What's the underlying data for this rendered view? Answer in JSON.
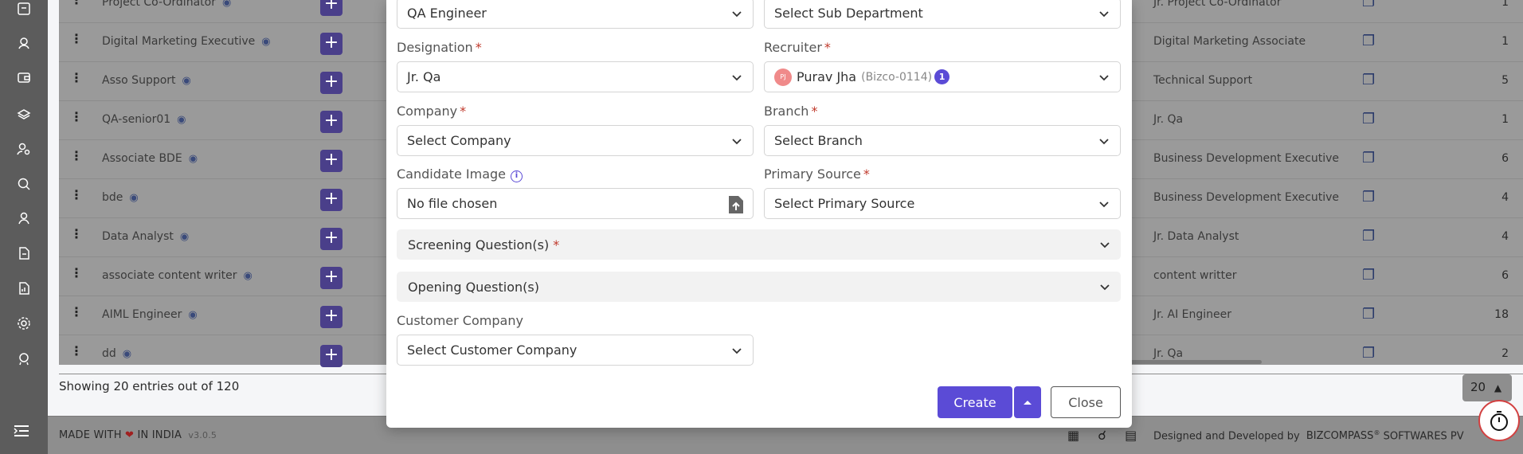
{
  "sidebar": {
    "icons": [
      "archive-icon",
      "users-icon",
      "wallet-icon",
      "layers-icon",
      "user-search-icon",
      "search-person-icon",
      "hr-icon",
      "document-icon",
      "report-icon",
      "settings-icon",
      "support-icon"
    ],
    "menu_icon": "menu-collapse-icon"
  },
  "background_table": {
    "rows": [
      {
        "name": "Project Co-Ordinator",
        "designation": "Jr. Project Co-Ordinator",
        "count": "1"
      },
      {
        "name": "Digital Marketing Executive",
        "designation": "Digital Marketing Associate",
        "count": "1"
      },
      {
        "name": "Asso Support",
        "designation": "Technical Support",
        "count": "5"
      },
      {
        "name": "QA-senior01",
        "designation": "Jr. Qa",
        "count": "1"
      },
      {
        "name": "Associate BDE",
        "designation": "Business Development Executive",
        "count": "6"
      },
      {
        "name": "bde",
        "designation": "Business Development Executive",
        "count": "4"
      },
      {
        "name": "Data Analyst",
        "designation": "Jr. Data Analyst",
        "count": "4"
      },
      {
        "name": "associate content writer",
        "designation": "content writter",
        "count": "6"
      },
      {
        "name": "AIML Engineer",
        "designation": "Jr. AI Engineer",
        "count": "18"
      },
      {
        "name": "dd",
        "designation": "Jr. Qa",
        "count": "2"
      }
    ],
    "showing_text": "Showing 20 entries out of 120",
    "page_size": "20"
  },
  "footer": {
    "made_with": "MADE WITH",
    "in_india": "IN INDIA",
    "version": "v3.0.5",
    "developed_by": "Designed and Developed by",
    "company": "BIZCOMPASS",
    "company_suffix": "SOFTWARES PV"
  },
  "modal": {
    "department_value": "QA Engineer",
    "sub_department_placeholder": "Select Sub Department",
    "designation_label": "Designation",
    "designation_value": "Jr. Qa",
    "recruiter_label": "Recruiter",
    "recruiter_initials": "PJ",
    "recruiter_name": "Purav Jha",
    "recruiter_code": "(Bizco-0114)",
    "recruiter_badge": "1",
    "company_label": "Company",
    "company_placeholder": "Select Company",
    "branch_label": "Branch",
    "branch_placeholder": "Select Branch",
    "candidate_image_label": "Candidate Image",
    "file_status": "No file chosen",
    "primary_source_label": "Primary Source",
    "primary_source_placeholder": "Select Primary Source",
    "screening_questions": "Screening Question(s)",
    "opening_questions": "Opening Question(s)",
    "customer_company_label": "Customer Company",
    "customer_company_placeholder": "Select Customer Company",
    "create_label": "Create",
    "close_label": "Close",
    "required_mark": "*"
  },
  "colors": {
    "primary": "#5b4bd6",
    "required": "#c0392b",
    "sidebar": "#5c5c5c"
  }
}
